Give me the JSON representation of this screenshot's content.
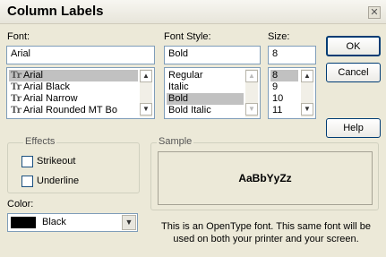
{
  "title": "Column Labels",
  "font": {
    "label": "Font:",
    "value": "Arial",
    "items": [
      {
        "glyph": "Tr",
        "name": "Arial"
      },
      {
        "glyph": "Tr",
        "name": "Arial Black"
      },
      {
        "glyph": "Tr",
        "name": "Arial Narrow"
      },
      {
        "glyph": "Tr",
        "name": "Arial Rounded MT Bo"
      }
    ]
  },
  "style": {
    "label": "Font Style:",
    "value": "Bold",
    "items": [
      "Regular",
      "Italic",
      "Bold",
      "Bold Italic"
    ]
  },
  "size": {
    "label": "Size:",
    "value": "8",
    "items": [
      "8",
      "9",
      "10",
      "11"
    ]
  },
  "buttons": {
    "ok": "OK",
    "cancel": "Cancel",
    "help": "Help"
  },
  "effects": {
    "label": "Effects",
    "strikeout": "Strikeout",
    "underline": "Underline"
  },
  "color": {
    "label": "Color:",
    "value": "Black",
    "swatch": "#000000"
  },
  "sample": {
    "label": "Sample",
    "text": "AaBbYyZz"
  },
  "description": "This is an OpenType font. This same font will be used on both your printer and your screen."
}
